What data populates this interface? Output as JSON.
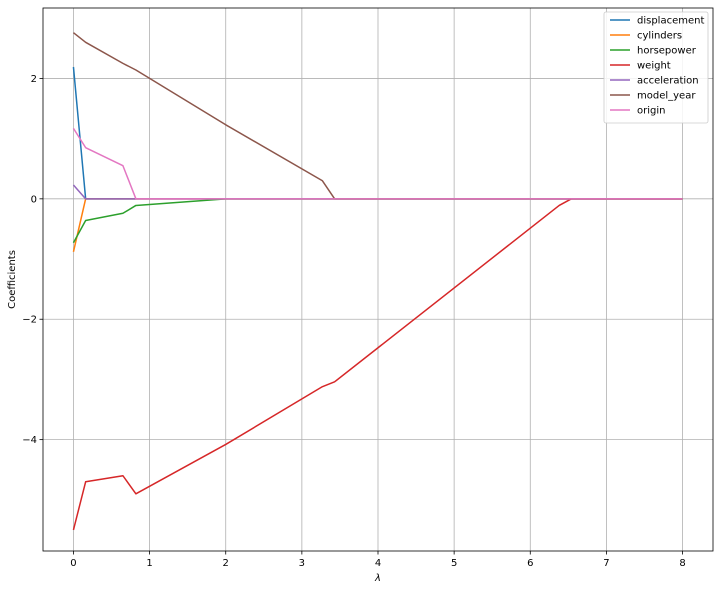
{
  "chart_data": {
    "type": "line",
    "title": "",
    "xlabel": "λ",
    "ylabel": "Coefficients",
    "xlim": [
      -0.4,
      8.4
    ],
    "ylim": [
      -5.85,
      3.17
    ],
    "xticks": [
      0,
      1,
      2,
      3,
      4,
      5,
      6,
      7,
      8
    ],
    "yticks": [
      -4,
      -2,
      0,
      2
    ],
    "ytick_labels": [
      "−4",
      "−2",
      "0",
      "2"
    ],
    "grid": true,
    "legend_position": "top-right",
    "series": [
      {
        "name": "displacement",
        "color": "#1f77b4",
        "x": [
          0,
          0.16,
          0.65,
          0.82,
          2,
          3.27,
          3.43,
          6.38,
          6.54,
          8
        ],
        "y": [
          2.19,
          0,
          0,
          0,
          0,
          0,
          0,
          0,
          0,
          0
        ]
      },
      {
        "name": "cylinders",
        "color": "#ff7f0e",
        "x": [
          0,
          0.16,
          0.65,
          0.82,
          2,
          3.27,
          3.43,
          6.38,
          6.54,
          8
        ],
        "y": [
          -0.88,
          0,
          0,
          0,
          0,
          0,
          0,
          0,
          0,
          0
        ]
      },
      {
        "name": "horsepower",
        "color": "#2ca02c",
        "x": [
          0,
          0.16,
          0.65,
          0.82,
          2,
          3.27,
          3.43,
          6.38,
          6.54,
          8
        ],
        "y": [
          -0.73,
          -0.36,
          -0.24,
          -0.11,
          0,
          0,
          0,
          0,
          0,
          0
        ]
      },
      {
        "name": "weight",
        "color": "#d62728",
        "x": [
          0,
          0.16,
          0.65,
          0.82,
          2,
          3.27,
          3.43,
          6.38,
          6.54,
          8
        ],
        "y": [
          -5.5,
          -4.7,
          -4.6,
          -4.9,
          -4.08,
          -3.12,
          -3.04,
          -0.11,
          0,
          0
        ]
      },
      {
        "name": "acceleration",
        "color": "#9467bd",
        "x": [
          0,
          0.16,
          0.65,
          0.82,
          2,
          3.27,
          3.43,
          6.38,
          6.54,
          8
        ],
        "y": [
          0.23,
          0,
          0,
          0,
          0,
          0,
          0,
          0,
          0,
          0
        ]
      },
      {
        "name": "model_year",
        "color": "#8c564b",
        "x": [
          0,
          0.16,
          0.65,
          0.82,
          2,
          3.27,
          3.43,
          6.38,
          6.54,
          8
        ],
        "y": [
          2.76,
          2.6,
          2.25,
          2.14,
          1.23,
          0.3,
          0,
          0,
          0,
          0
        ]
      },
      {
        "name": "origin",
        "color": "#e377c2",
        "x": [
          0,
          0.16,
          0.65,
          0.82,
          2,
          3.27,
          3.43,
          6.38,
          6.54,
          8
        ],
        "y": [
          1.17,
          0.85,
          0.55,
          0,
          0,
          0,
          0,
          0,
          0,
          0
        ]
      }
    ]
  }
}
